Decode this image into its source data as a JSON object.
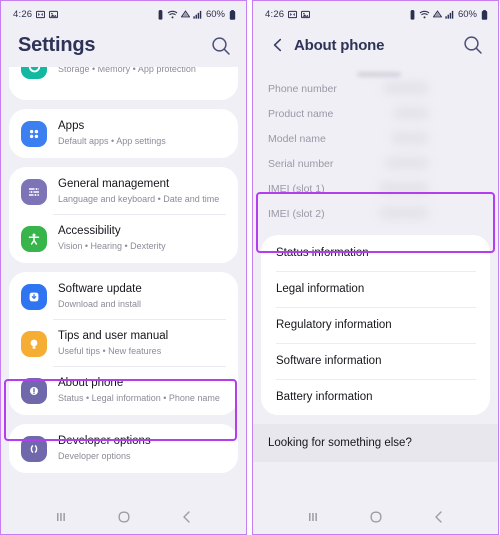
{
  "statusbar": {
    "time": "4:26",
    "left_icons": [
      "dnd-icon",
      "image-icon"
    ],
    "battery_percent": "60%",
    "right_icons": [
      "alarm-icon",
      "wifi-icon",
      "signal-icon",
      "signal-bars-icon",
      "battery-icon"
    ]
  },
  "left_phone": {
    "title": "Settings",
    "search_icon": "search-icon",
    "partial_row": {
      "subtitle": "Storage  •  Memory  •  App protection",
      "icon": "device-care-icon",
      "icon_color": "#12b8a0"
    },
    "groups": [
      {
        "rows": [
          {
            "title": "Apps",
            "subtitle": "Default apps  •  App settings",
            "icon": "apps-grid-icon",
            "icon_color": "#3b7ff0"
          }
        ]
      },
      {
        "rows": [
          {
            "title": "General management",
            "subtitle": "Language and keyboard  •  Date and time",
            "icon": "sliders-icon",
            "icon_color": "#7d74b8"
          },
          {
            "title": "Accessibility",
            "subtitle": "Vision  •  Hearing  •  Dexterity",
            "icon": "accessibility-person-icon",
            "icon_color": "#37b44a"
          }
        ]
      },
      {
        "rows": [
          {
            "title": "Software update",
            "subtitle": "Download and install",
            "icon": "software-update-icon",
            "icon_color": "#2f74f0"
          },
          {
            "title": "Tips and user manual",
            "subtitle": "Useful tips  •  New features",
            "icon": "lightbulb-icon",
            "icon_color": "#f5ad33"
          },
          {
            "title": "About phone",
            "subtitle": "Status  •  Legal information  •  Phone name",
            "icon": "info-circle-icon",
            "icon_color": "#6f68aa",
            "highlighted": true
          }
        ]
      },
      {
        "rows": [
          {
            "title": "Developer options",
            "subtitle": "Developer options",
            "icon": "code-braces-icon",
            "icon_color": "#6f68aa"
          }
        ]
      }
    ]
  },
  "right_phone": {
    "title": "About phone",
    "back_icon": "back-chevron-icon",
    "search_icon": "search-icon",
    "info_rows": [
      {
        "label": "Phone number",
        "value_redacted": true
      },
      {
        "label": "Product name",
        "value_redacted": true
      },
      {
        "label": "Model name",
        "value_redacted": true
      },
      {
        "label": "Serial number",
        "value_redacted": true
      },
      {
        "label": "IMEI (slot 1)",
        "value_redacted": true,
        "highlighted": true
      },
      {
        "label": "IMEI (slot 2)",
        "value_redacted": true,
        "highlighted": true
      }
    ],
    "menu_items": [
      "Status information",
      "Legal information",
      "Regulatory information",
      "Software information",
      "Battery information"
    ],
    "footer": "Looking for something else?"
  },
  "navbar": {
    "recents_icon": "recents-icon",
    "home_icon": "home-circle-icon",
    "back_icon": "back-chevron-icon"
  },
  "colors": {
    "highlight": "#b43df0",
    "phone_border": "#c77ef0",
    "page_bg": "#f0eff5",
    "card_bg": "#ffffff",
    "title_text": "#2e3358"
  }
}
